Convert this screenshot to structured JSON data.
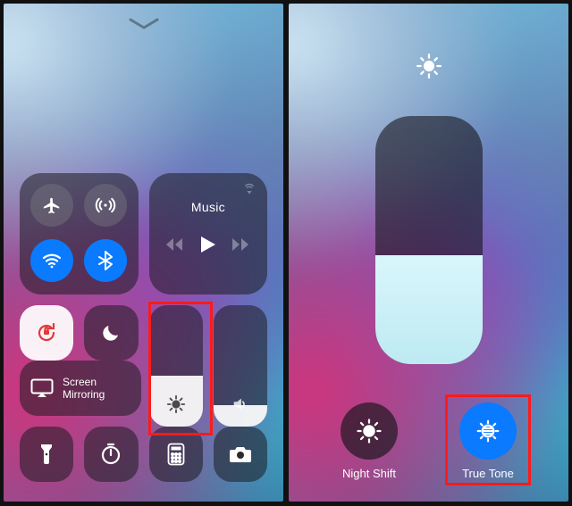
{
  "left": {
    "media_label": "Music",
    "screen_mirroring_line1": "Screen",
    "screen_mirroring_line2": "Mirroring",
    "brightness_fill_pct": 42,
    "volume_fill_pct": 18
  },
  "right": {
    "brightness_fill_pct": 44,
    "night_shift_label": "Night Shift",
    "true_tone_label": "True Tone"
  }
}
